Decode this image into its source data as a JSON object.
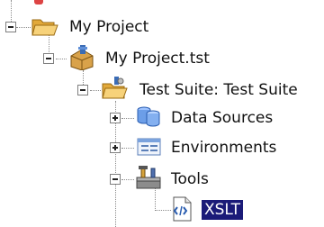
{
  "tree": {
    "nodes": [
      {
        "id": "my-project",
        "label": "My Project",
        "icon": "folder-open-icon",
        "expanded": true
      },
      {
        "id": "my-project-tst",
        "label": "My Project.tst",
        "icon": "project-tools-icon",
        "expanded": true
      },
      {
        "id": "test-suite",
        "label": "Test Suite: Test Suite",
        "icon": "test-suite-folder-icon",
        "expanded": true
      },
      {
        "id": "data-sources",
        "label": "Data Sources",
        "icon": "database-icon",
        "expanded": false
      },
      {
        "id": "environments",
        "label": "Environments",
        "icon": "environment-window-icon",
        "expanded": false
      },
      {
        "id": "tools",
        "label": "Tools",
        "icon": "toolbox-icon",
        "expanded": true
      },
      {
        "id": "xslt",
        "label": "XSLT",
        "icon": "xslt-document-icon",
        "selected": true
      }
    ]
  },
  "colors": {
    "selection": "#1b1b78",
    "folder": "#f2c35a",
    "guide": "#8c8c8c"
  }
}
